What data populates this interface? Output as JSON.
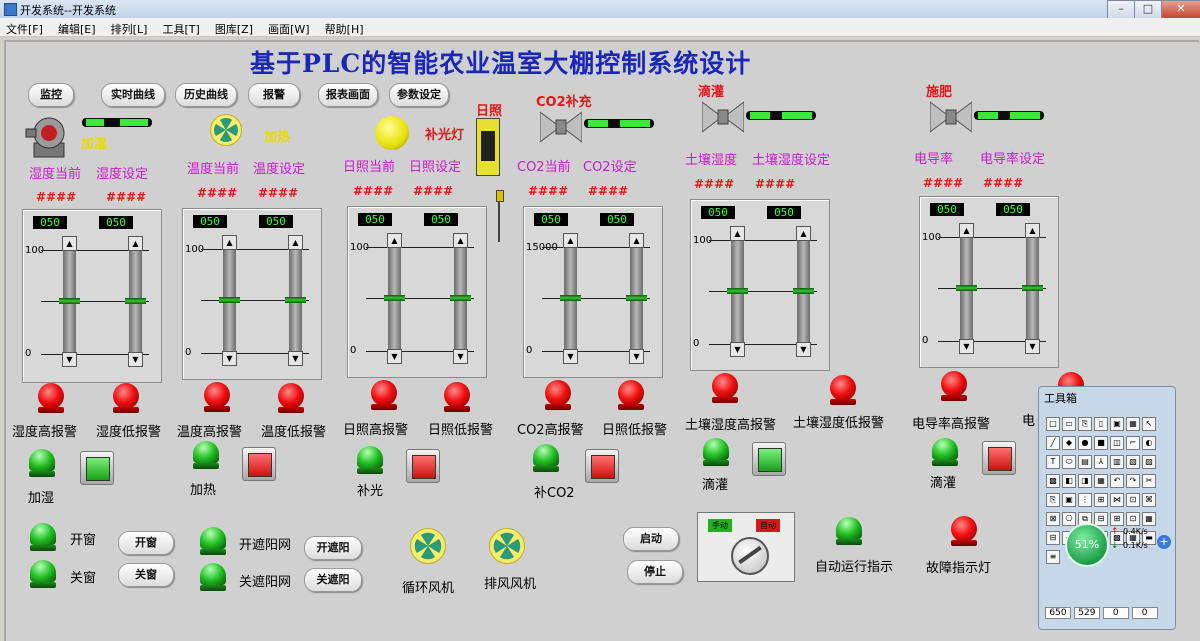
{
  "window": {
    "title": "开发系统--开发系统",
    "buttons": [
      "–",
      "□",
      "✕"
    ]
  },
  "menu": [
    "文件[F]",
    "编辑[E]",
    "排列[L]",
    "工具[T]",
    "图库[Z]",
    "画面[W]",
    "帮助[H]"
  ],
  "title": "基于PLC的智能农业温室大棚控制系统设计",
  "nav": [
    "监控",
    "实时曲线",
    "历史曲线",
    "报警",
    "报表画面",
    "参数设定"
  ],
  "devices": {
    "humidify": "加湿",
    "heat": "加热",
    "light_lamp": "补光灯",
    "sunlight": "日照",
    "co2": "CO2补充",
    "drip": "滴灌",
    "fertilize": "施肥"
  },
  "labels": {
    "hum_cur": "湿度当前",
    "hum_set": "湿度设定",
    "temp_cur": "温度当前",
    "temp_set": "温度设定",
    "sun_cur": "日照当前",
    "sun_set": "日照设定",
    "co2_cur": "CO2当前",
    "co2_set": "CO2设定",
    "soil_cur": "土壤湿度",
    "soil_set": "土壤湿度设定",
    "ec_cur": "电导率",
    "ec_set": "电导率设定"
  },
  "hash": "####",
  "panels": [
    {
      "disp1": "050",
      "disp2": "050",
      "max": "100",
      "min": "0"
    },
    {
      "disp1": "050",
      "disp2": "050",
      "max": "100",
      "min": "0"
    },
    {
      "disp1": "050",
      "disp2": "050",
      "max": "100",
      "min": "0"
    },
    {
      "disp1": "050",
      "disp2": "050",
      "max": "15000",
      "min": "0"
    },
    {
      "disp1": "050",
      "disp2": "050",
      "max": "100",
      "min": "0"
    },
    {
      "disp1": "050",
      "disp2": "050",
      "max": "100",
      "min": "0"
    }
  ],
  "alarms": [
    "湿度高报警",
    "湿度低报警",
    "温度高报警",
    "温度低报警",
    "日照高报警",
    "日照低报警",
    "CO2高报警",
    "日照低报警",
    "土壤湿度高报警",
    "土壤湿度低报警",
    "电导率高报警",
    "电"
  ],
  "outputs": [
    "加湿",
    "加热",
    "补光",
    "补CO2",
    "滴灌",
    "滴灌"
  ],
  "bottom": {
    "open_win": "开窗",
    "close_win": "关窗",
    "open_shade": "开遮阳网",
    "close_shade": "关遮阳网",
    "btn_open_win": "开窗",
    "btn_close_win": "关窗",
    "btn_open_shade": "开遮阳",
    "btn_close_shade": "关遮阳",
    "fan1": "循环风机",
    "fan2": "排风风机",
    "start": "启动",
    "stop": "停止",
    "manual": "手动",
    "auto": "自动",
    "auto_ind": "自动运行指示",
    "fault_ind": "故障指示灯"
  },
  "toolbox": {
    "title": "工具箱",
    "percent": "51%",
    "up": "0.4K/s",
    "down": "0.1K/s",
    "coords": [
      "650",
      "529",
      "0",
      "0"
    ]
  },
  "colors": {
    "title": "#1a27b8",
    "magenta": "#c81bc8",
    "alarm_red": "#f01010",
    "ok_green": "#20c020"
  }
}
